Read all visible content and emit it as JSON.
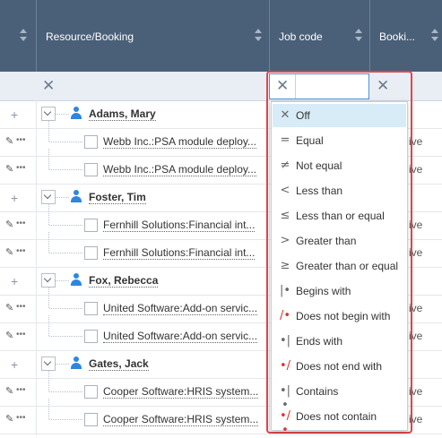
{
  "columns": {
    "resource": "Resource/Booking",
    "jobcode": "Job code",
    "booking": "Booki..."
  },
  "filter_row": {
    "clear_symbol": "✕",
    "job_code_value": ""
  },
  "rows": [
    {
      "type": "resource",
      "name": "Adams, Mary"
    },
    {
      "type": "booking",
      "name": "Webb Inc.:PSA module deploy...",
      "tail": "ive"
    },
    {
      "type": "booking",
      "name": "Webb Inc.:PSA module deploy...",
      "tail": "ive"
    },
    {
      "type": "resource",
      "name": "Foster, Tim"
    },
    {
      "type": "booking",
      "name": "Fernhill Solutions:Financial int...",
      "tail": "ive"
    },
    {
      "type": "booking",
      "name": "Fernhill Solutions:Financial int...",
      "tail": "ive"
    },
    {
      "type": "resource",
      "name": "Fox, Rebecca"
    },
    {
      "type": "booking",
      "name": "United Software:Add-on servic...",
      "tail": "ive"
    },
    {
      "type": "booking",
      "name": "United Software:Add-on servic...",
      "tail": "ive"
    },
    {
      "type": "resource",
      "name": "Gates, Jack"
    },
    {
      "type": "booking",
      "name": "Cooper Software:HRIS system...",
      "tail": "ive"
    },
    {
      "type": "booking",
      "name": "Cooper Software:HRIS system...",
      "tail": "ive"
    }
  ],
  "filter_menu": {
    "selected": "Off",
    "items": [
      {
        "symbol": "✕",
        "label": "Off"
      },
      {
        "symbol": "=",
        "label": "Equal"
      },
      {
        "symbol": "≠",
        "label": "Not equal"
      },
      {
        "symbol": "<",
        "label": "Less than"
      },
      {
        "symbol": "≤",
        "label": "Less than or equal"
      },
      {
        "symbol": ">",
        "label": "Greater than"
      },
      {
        "symbol": "≥",
        "label": "Greater than or equal"
      },
      {
        "symbol": "|•",
        "label": "Begins with"
      },
      {
        "symbol": "/•",
        "label": "Does not begin with"
      },
      {
        "symbol": "•|",
        "label": "Ends with"
      },
      {
        "symbol": "•/",
        "label": "Does not end with"
      },
      {
        "symbol": "•|•",
        "label": "Contains"
      },
      {
        "symbol": "•/•",
        "label": "Does not contain"
      }
    ]
  },
  "colors": {
    "header_bg": "#4a5f78",
    "accent_blue": "#2e86de",
    "highlight_red": "#e0474c",
    "selected_bg": "#d7ecf7"
  }
}
